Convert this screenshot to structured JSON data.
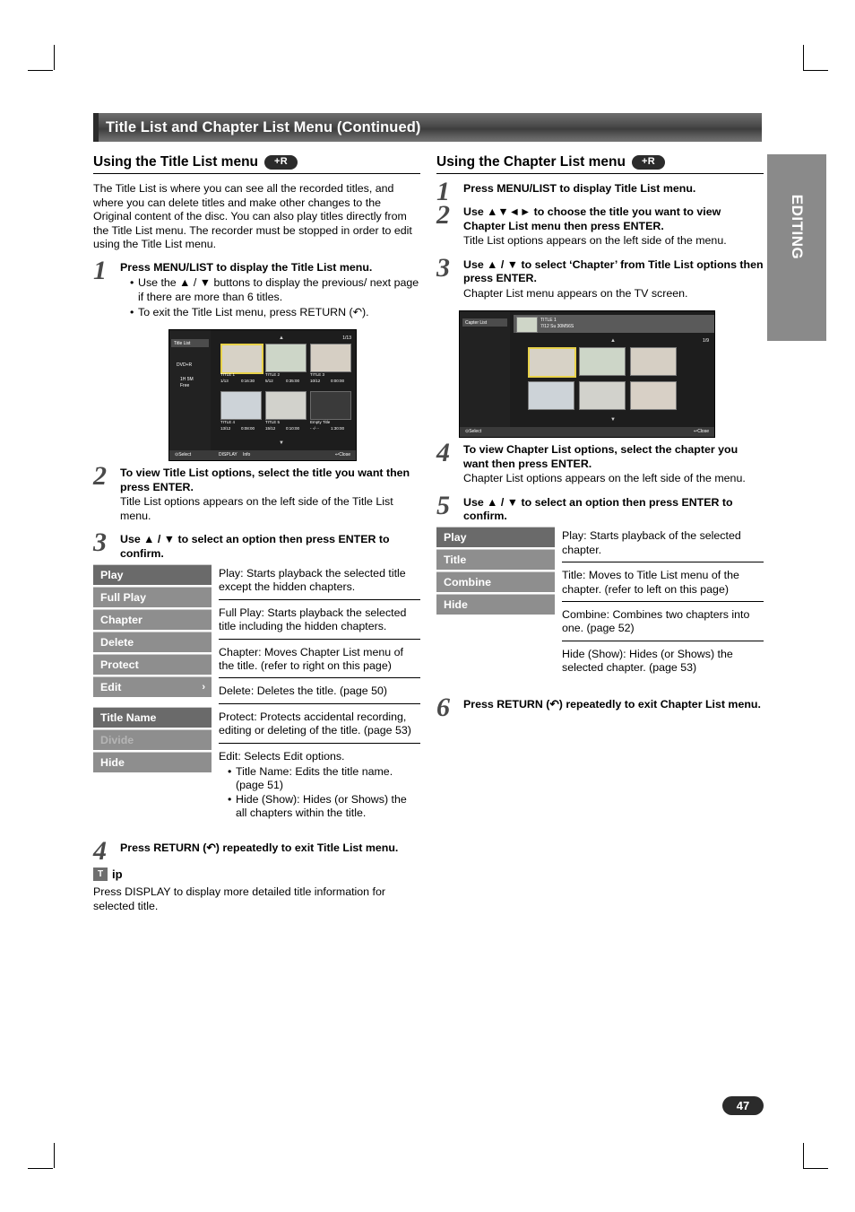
{
  "header": {
    "title": "Title List and Chapter List Menu (Continued)"
  },
  "side_tab": {
    "label": "EDITING"
  },
  "page_number": "47",
  "left": {
    "section_title": "Using the Title List menu",
    "badge": "+R",
    "intro": "The Title List is where you can see all the recorded titles, and where you can delete titles and make other changes to the Original content of the disc. You can also play titles directly from the Title List menu. The recorder must be stopped in order to edit using the Title List menu.",
    "steps": [
      {
        "num": "1",
        "head": "Press MENU/LIST to display the Title List menu.",
        "bullets": [
          "Use the ▲ / ▼ buttons to display the previous/ next page if there are more than 6 titles.",
          "To exit the Title List menu, press RETURN (↶)."
        ]
      },
      {
        "num": "2",
        "head": "To view Title List options, select the title you want then press ENTER.",
        "sub": "Title List options appears on the left side of the Title List menu."
      },
      {
        "num": "3",
        "head": "Use ▲ / ▼ to select an option then press ENTER to confirm."
      },
      {
        "num": "4",
        "head": "Press RETURN (↶) repeatedly to exit Title List menu."
      }
    ],
    "options_menu": [
      "Play",
      "Full Play",
      "Chapter",
      "Delete",
      "Protect",
      "Edit"
    ],
    "options_menu2": [
      "Title Name",
      "Divide",
      "Hide"
    ],
    "options_desc": [
      "Play: Starts playback the selected title except the hidden chapters.",
      "Full Play: Starts playback the selected title including the hidden chapters.",
      "Chapter: Moves Chapter List menu of the title. (refer to right on this page)",
      "Delete: Deletes the title. (page 50)",
      "Protect: Protects accidental recording, editing or deleting of the title. (page 53)",
      "Edit: Selects Edit options."
    ],
    "edit_subitems": [
      "Title Name: Edits the title name. (page 51)",
      "Hide (Show): Hides (or Shows) the all chapters within the title."
    ],
    "tip": {
      "label": "ip",
      "icon": "T",
      "text": "Press DISPLAY to display more detailed title information for selected title."
    },
    "tv": {
      "panel_title": "Title List",
      "disc_type": "DVD+R",
      "free_label_1": "1H 5M",
      "free_label_2": "Free",
      "page_indicator": "1/13",
      "items": [
        {
          "name": "TITLE 1",
          "date": "1/13",
          "time": "0:16:30"
        },
        {
          "name": "TITLE 2",
          "date": "5/12",
          "time": "0:35:00"
        },
        {
          "name": "TITLE 3",
          "date": "10/12",
          "time": "0:00:00"
        },
        {
          "name": "TITLE 4",
          "date": "13/12",
          "time": "0:08:00"
        },
        {
          "name": "TITLE 5",
          "date": "15/12",
          "time": "0:10:00"
        },
        {
          "name": "Empty Title",
          "date": "- -/- -",
          "time": "1:30:00"
        }
      ],
      "bottom": [
        "Select",
        "DISPLAY",
        "Info",
        "Close"
      ]
    }
  },
  "right": {
    "section_title": "Using the Chapter List menu",
    "badge": "+R",
    "steps": [
      {
        "num": "1",
        "head": "Press MENU/LIST to display Title List menu."
      },
      {
        "num": "2",
        "head": "Use ▲▼◄► to choose the title you want to view Chapter List menu then press ENTER.",
        "sub": "Title List options appears on the left side of the menu."
      },
      {
        "num": "3",
        "head": "Use ▲ / ▼ to select ‘Chapter’ from Title List options then press ENTER.",
        "sub": "Chapter List menu appears on the TV screen."
      },
      {
        "num": "4",
        "head": "To view Chapter List options, select the chapter you want then press ENTER.",
        "sub": "Chapter List options appears on the left side of the menu."
      },
      {
        "num": "5",
        "head": "Use ▲ / ▼ to select an option then press ENTER to confirm."
      },
      {
        "num": "6",
        "head": "Press RETURN (↶) repeatedly to exit Chapter List menu."
      }
    ],
    "options_menu": [
      "Play",
      "Title",
      "Combine",
      "Hide"
    ],
    "options_desc": [
      "Play: Starts playback of the selected chapter.",
      "Title: Moves to Title List menu of the chapter. (refer to left on this page)",
      "Combine: Combines two chapters into one. (page 52)",
      "Hide (Show): Hides (or Shows) the selected chapter. (page 53)"
    ],
    "tv": {
      "panel_title": "Capter List",
      "header_title": "TITLE 1",
      "header_sub": "7/12  Su    30M56S",
      "page_indicator": "1/9",
      "bottom": [
        "Select",
        "Close"
      ]
    }
  }
}
